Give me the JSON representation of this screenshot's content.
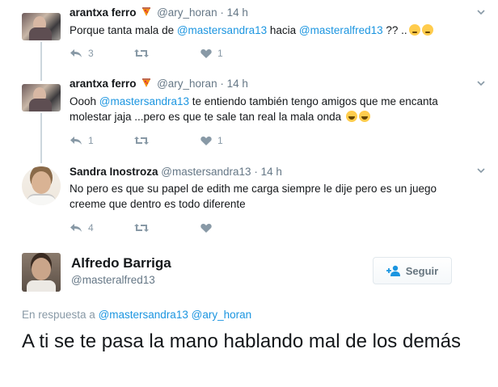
{
  "thread": [
    {
      "name": "arantxa ferro",
      "handle": "@ary_horan",
      "separator": "·",
      "time": "14 h",
      "text_pre": "Porque tanta mala  de ",
      "mention1": "@mastersandra13",
      "text_mid": "  hacia ",
      "mention2": "@masteralfred13",
      "text_post": " ?? ..",
      "reply_count": "3",
      "retweet_count": "",
      "like_count": "1"
    },
    {
      "name": "arantxa ferro",
      "handle": "@ary_horan",
      "separator": "·",
      "time": "14 h",
      "text_pre": "Oooh  ",
      "mention1": "@mastersandra13",
      "text_post": " te entiendo también tengo amigos que me encanta molestar jaja ...pero es que te sale tan real la mala onda ",
      "reply_count": "1",
      "retweet_count": "",
      "like_count": "1"
    },
    {
      "name": "Sandra Inostroza",
      "handle": "@mastersandra13",
      "separator": "·",
      "time": "14 h",
      "text": "No pero es que su papel de edith me carga siempre le dije pero es un juego creeme que dentro es todo diferente",
      "reply_count": "4",
      "retweet_count": "",
      "like_count": ""
    }
  ],
  "main_tweet": {
    "name": "Alfredo Barriga",
    "handle": "@masteralfred13",
    "follow_label": "Seguir",
    "reply_prefix": "En respuesta a",
    "reply_mention1": "@mastersandra13",
    "reply_mention2": "@ary_horan",
    "text": "A ti se te pasa la mano hablando mal de los demás"
  },
  "colors": {
    "link": "#1b95e0",
    "muted": "#8899a6",
    "thread_line": "#ccd6dd"
  },
  "icons": [
    "reply-icon",
    "retweet-icon",
    "like-icon",
    "chevron-down-icon",
    "pizza-icon",
    "follow-person-icon",
    "thinking-emoji",
    "laughing-emoji"
  ]
}
